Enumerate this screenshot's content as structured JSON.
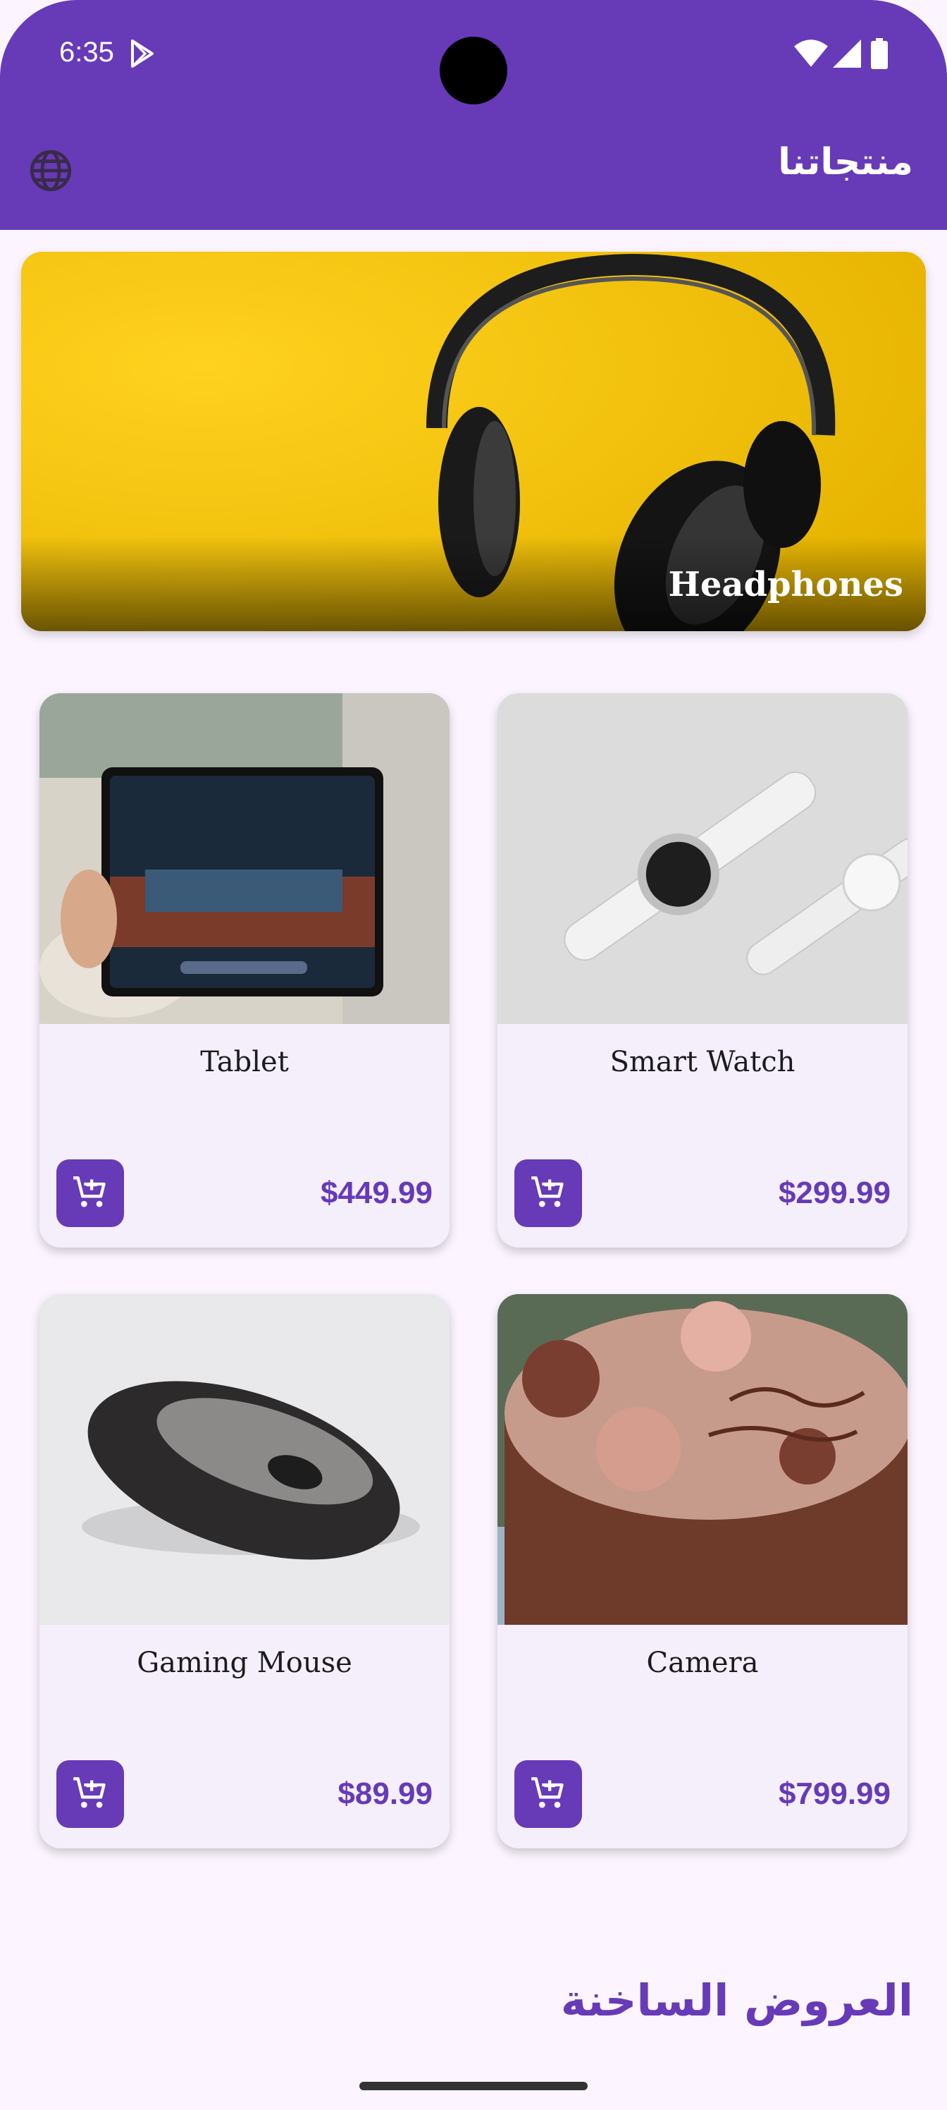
{
  "status_bar": {
    "time": "6:35"
  },
  "app_bar": {
    "title": "منتجاتنا"
  },
  "banner": {
    "title": "Headphones"
  },
  "products": [
    {
      "name": "Tablet",
      "price": "$449.99"
    },
    {
      "name": "Smart Watch",
      "price": "$299.99"
    },
    {
      "name": "Gaming Mouse",
      "price": "$89.99"
    },
    {
      "name": "Camera",
      "price": "$799.99"
    }
  ],
  "hot_deals": {
    "title": "العروض الساخنة"
  },
  "colors": {
    "primary": "#673ab7",
    "background": "#fcf5ff",
    "card": "#f4effa"
  }
}
